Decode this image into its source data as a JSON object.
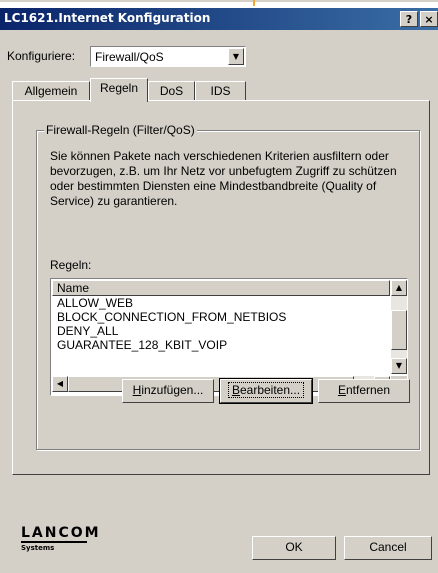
{
  "window": {
    "title": "LC1621.Internet Konfiguration",
    "help_button": "?",
    "close_button": "×"
  },
  "configure": {
    "label": "Konfiguriere:",
    "selected": "Firewall/QoS"
  },
  "tabs": [
    {
      "label": "Allgemein",
      "active": false
    },
    {
      "label": "Regeln",
      "active": true
    },
    {
      "label": "DoS",
      "active": false
    },
    {
      "label": "IDS",
      "active": false
    }
  ],
  "group": {
    "title": "Firewall-Regeln (Filter/QoS)",
    "description": "Sie können Pakete nach verschiedenen Kriterien ausfiltern oder bevorzugen, z.B. um Ihr Netz vor unbefugtem Zugriff zu schützen oder bestimmten Diensten eine Mindestbandbreite (Quality of Service) zu garantieren.",
    "rules_label": "Regeln:"
  },
  "rules_list": {
    "column_header": "Name",
    "rows": [
      "ALLOW_WEB",
      "BLOCK_CONNECTION_FROM_NETBIOS",
      "DENY_ALL",
      "GUARANTEE_128_KBIT_VOIP"
    ]
  },
  "buttons": {
    "add_pre": "",
    "add_mnemonic": "H",
    "add_post": "inzufügen...",
    "edit_pre": "",
    "edit_mnemonic": "B",
    "edit_post": "earbeiten...",
    "remove_pre": "",
    "remove_mnemonic": "E",
    "remove_post": "ntfernen",
    "ok": "OK",
    "cancel": "Cancel"
  },
  "logo": {
    "word": "LANCOM",
    "sub": "Systems"
  },
  "colors": {
    "title_gradient_start": "#0a246a",
    "title_gradient_end": "#3a6ea5",
    "dialog_bg": "#d4d0c8"
  }
}
